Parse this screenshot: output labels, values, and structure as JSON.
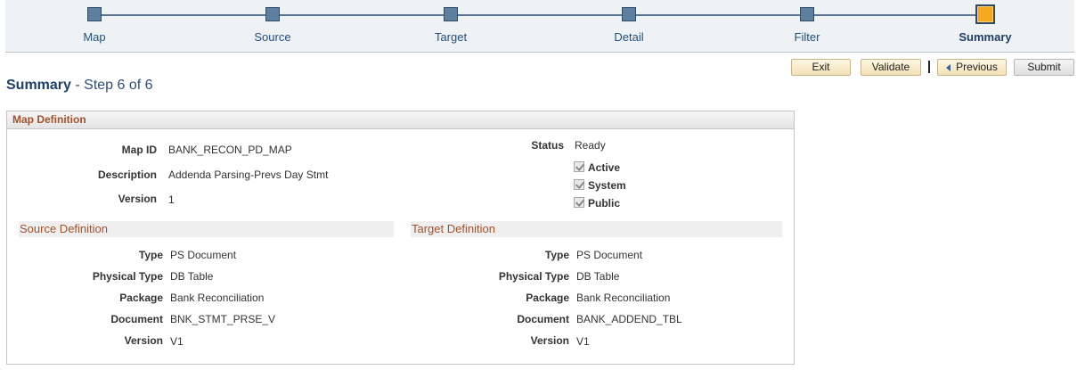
{
  "train": {
    "steps": [
      {
        "label": "Map"
      },
      {
        "label": "Source"
      },
      {
        "label": "Target"
      },
      {
        "label": "Detail"
      },
      {
        "label": "Filter"
      },
      {
        "label": "Summary"
      }
    ],
    "current_index": 5
  },
  "toolbar": {
    "exit_label": "Exit",
    "validate_label": "Validate",
    "previous_label": "Previous",
    "submit_label": "Submit"
  },
  "page": {
    "title": "Summary",
    "step_text": " - Step 6 of 6"
  },
  "map_definition": {
    "heading": "Map Definition",
    "map_id_label": "Map ID",
    "map_id": "BANK_RECON_PD_MAP",
    "description_label": "Description",
    "description": "Addenda Parsing-Prevs Day Stmt",
    "version_label": "Version",
    "version": "1",
    "status_label": "Status",
    "status": "Ready",
    "flags": [
      {
        "label": "Active",
        "checked": true
      },
      {
        "label": "System",
        "checked": true
      },
      {
        "label": "Public",
        "checked": true
      }
    ]
  },
  "source_definition": {
    "heading": "Source Definition",
    "type_label": "Type",
    "type": "PS Document",
    "physical_type_label": "Physical Type",
    "physical_type": "DB Table",
    "package_label": "Package",
    "package": "Bank Reconciliation",
    "document_label": "Document",
    "document": "BNK_STMT_PRSE_V",
    "version_label": "Version",
    "version": "V1"
  },
  "target_definition": {
    "heading": "Target Definition",
    "type_label": "Type",
    "type": "PS Document",
    "physical_type_label": "Physical Type",
    "physical_type": "DB Table",
    "package_label": "Package",
    "package": "Bank Reconciliation",
    "document_label": "Document",
    "document": "BANK_ADDEND_TBL",
    "version_label": "Version",
    "version": "V1"
  },
  "colors": {
    "accent": "#1f3f66",
    "section_heading": "#a0522d",
    "current_step": "#f7a823",
    "step_node": "#5f7f9e"
  }
}
